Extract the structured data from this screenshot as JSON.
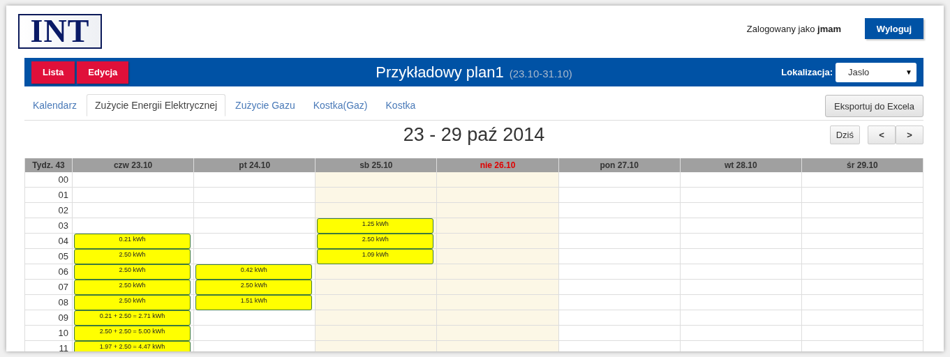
{
  "logo": {
    "text": "INT"
  },
  "user": {
    "prefix": "Zalogowany jako",
    "name": "jmam"
  },
  "logout_button": "Wyloguj",
  "toolbar": {
    "buttons": [
      "Lista",
      "Edycja"
    ],
    "title": "Przykładowy plan1",
    "range": "(23.10-31.10)",
    "location_label": "Lokalizacja:",
    "location_value": "Jaslo",
    "location_caret": "▼"
  },
  "tabs": [
    {
      "label": "Kalendarz",
      "selected": false
    },
    {
      "label": "Zużycie Energii Elektrycznej",
      "selected": true
    },
    {
      "label": "Zużycie Gazu",
      "selected": false
    },
    {
      "label": "Kostka(Gaz)",
      "selected": false
    },
    {
      "label": "Kostka",
      "selected": false
    }
  ],
  "export_button": "Eksportuj do Excela",
  "calendar": {
    "title": "23 - 29 paź 2014",
    "today_button": "Dziś",
    "prev": "<",
    "next": ">",
    "week_label": "Tydz. 43",
    "hours": [
      "00",
      "01",
      "02",
      "03",
      "04",
      "05",
      "06",
      "07",
      "08",
      "09",
      "10",
      "11"
    ],
    "days": [
      {
        "label": "czw 23.10",
        "weekend": false,
        "highlight": false,
        "slots": [
          {
            "kind": "empty"
          },
          {
            "kind": "empty"
          },
          {
            "kind": "empty"
          },
          {
            "kind": "empty"
          },
          {
            "kind": "event",
            "text": "0.21 kWh"
          },
          {
            "kind": "event",
            "text": "2.50 kWh"
          },
          {
            "kind": "event",
            "text": "2.50 kWh"
          },
          {
            "kind": "event",
            "text": "2.50 kWh"
          },
          {
            "kind": "event",
            "text": "2.50 kWh"
          },
          {
            "kind": "event",
            "text": "0.21 + 2.50 = 2.71 kWh"
          },
          {
            "kind": "event",
            "text": "2.50 + 2.50 = 5.00 kWh"
          },
          {
            "kind": "event",
            "text": "1.97 + 2.50 = 4.47 kWh"
          }
        ]
      },
      {
        "label": "pt 24.10",
        "weekend": false,
        "highlight": false,
        "slots": [
          {
            "kind": "empty"
          },
          {
            "kind": "empty"
          },
          {
            "kind": "empty"
          },
          {
            "kind": "empty"
          },
          {
            "kind": "empty"
          },
          {
            "kind": "empty"
          },
          {
            "kind": "event",
            "text": "0.42 kWh"
          },
          {
            "kind": "event",
            "text": "2.50 kWh"
          },
          {
            "kind": "event",
            "text": "1.51 kWh"
          },
          {
            "kind": "empty"
          },
          {
            "kind": "empty"
          },
          {
            "kind": "empty"
          }
        ]
      },
      {
        "label": "sb 25.10",
        "weekend": true,
        "highlight": false,
        "slots": [
          {
            "kind": "empty"
          },
          {
            "kind": "empty"
          },
          {
            "kind": "empty"
          },
          {
            "kind": "event",
            "text": "1.25 kWh"
          },
          {
            "kind": "event",
            "text": "2.50 kWh"
          },
          {
            "kind": "event",
            "text": "1.09 kWh"
          },
          {
            "kind": "empty"
          },
          {
            "kind": "empty"
          },
          {
            "kind": "empty"
          },
          {
            "kind": "empty"
          },
          {
            "kind": "empty"
          },
          {
            "kind": "empty"
          }
        ]
      },
      {
        "label": "nie 26.10",
        "weekend": true,
        "highlight": true
      },
      {
        "label": "pon 27.10",
        "weekend": false,
        "highlight": false
      },
      {
        "label": "wt 28.10",
        "weekend": false,
        "highlight": false
      },
      {
        "label": "śr 29.10",
        "weekend": false,
        "highlight": false
      }
    ]
  }
}
